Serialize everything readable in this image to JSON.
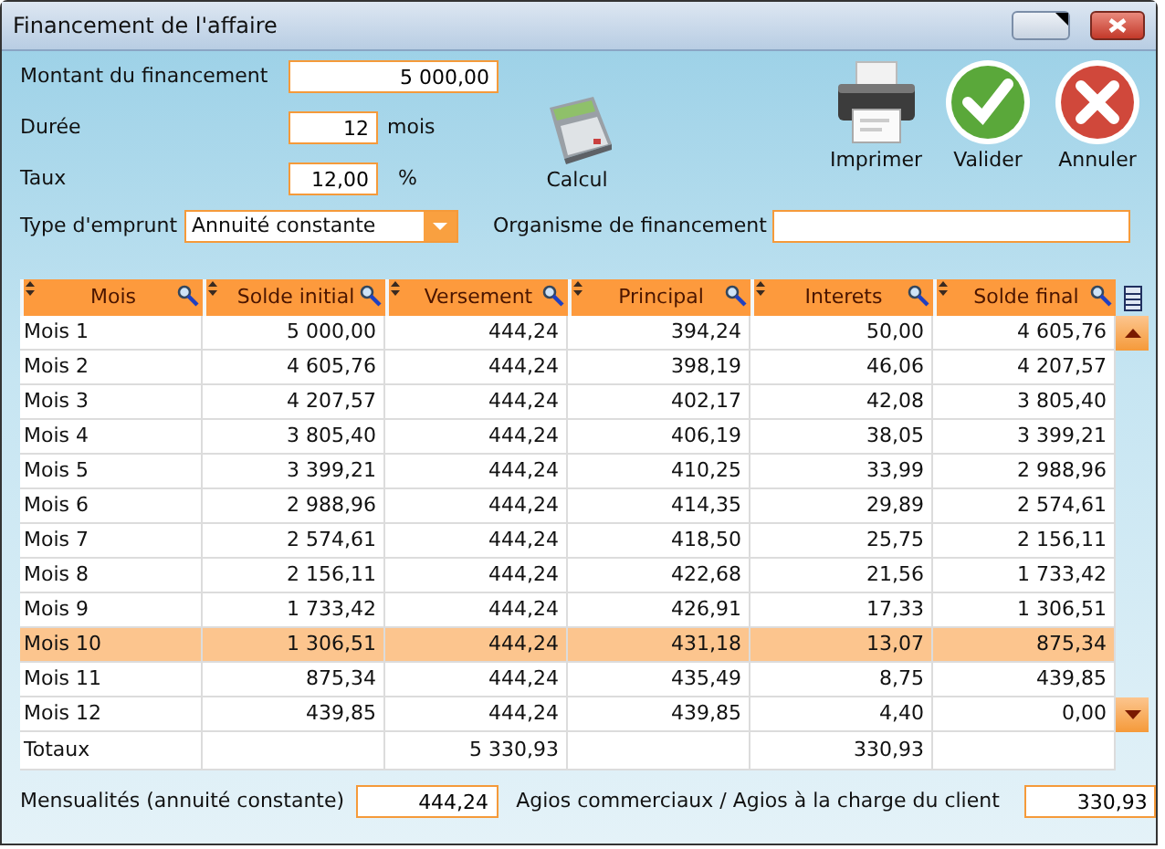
{
  "window": {
    "title": "Financement de l'affaire"
  },
  "amount": {
    "label": "Montant du financement",
    "value": "5 000,00"
  },
  "duration": {
    "label": "Durée",
    "value": "12",
    "unit": "mois"
  },
  "rate": {
    "label": "Taux",
    "value": "12,00",
    "unit": "%"
  },
  "actions": [
    {
      "label": "Calcul",
      "kind": "calculator"
    },
    {
      "label": "Imprimer",
      "kind": "print"
    },
    {
      "label": "Valider",
      "kind": "ok"
    },
    {
      "label": "Annuler",
      "kind": "cancel"
    }
  ],
  "loan_type": {
    "label": "Type d'emprunt",
    "value": "Annuité constante"
  },
  "lender": {
    "label": "Organisme de financement"
  },
  "table": {
    "columns": [
      "Mois",
      "Solde initial",
      "Versement",
      "Principal",
      "Interets",
      "Solde final"
    ],
    "rows": [
      {
        "selected": false,
        "cells": [
          "Mois 1",
          "5 000,00",
          "444,24",
          "394,24",
          "50,00",
          "4 605,76"
        ]
      },
      {
        "selected": false,
        "cells": [
          "Mois 2",
          "4 605,76",
          "444,24",
          "398,19",
          "46,06",
          "4 207,57"
        ]
      },
      {
        "selected": false,
        "cells": [
          "Mois 3",
          "4 207,57",
          "444,24",
          "402,17",
          "42,08",
          "3 805,40"
        ]
      },
      {
        "selected": false,
        "cells": [
          "Mois 4",
          "3 805,40",
          "444,24",
          "406,19",
          "38,05",
          "3 399,21"
        ]
      },
      {
        "selected": false,
        "cells": [
          "Mois 5",
          "3 399,21",
          "444,24",
          "410,25",
          "33,99",
          "2 988,96"
        ]
      },
      {
        "selected": false,
        "cells": [
          "Mois 6",
          "2 988,96",
          "444,24",
          "414,35",
          "29,89",
          "2 574,61"
        ]
      },
      {
        "selected": false,
        "cells": [
          "Mois 7",
          "2 574,61",
          "444,24",
          "418,50",
          "25,75",
          "2 156,11"
        ]
      },
      {
        "selected": false,
        "cells": [
          "Mois 8",
          "2 156,11",
          "444,24",
          "422,68",
          "21,56",
          "1 733,42"
        ]
      },
      {
        "selected": false,
        "cells": [
          "Mois 9",
          "1 733,42",
          "444,24",
          "426,91",
          "17,33",
          "1 306,51"
        ]
      },
      {
        "selected": true,
        "cells": [
          "Mois 10",
          "1 306,51",
          "444,24",
          "431,18",
          "13,07",
          "875,34"
        ]
      },
      {
        "selected": false,
        "cells": [
          "Mois 11",
          "875,34",
          "444,24",
          "435,49",
          "8,75",
          "439,85"
        ]
      },
      {
        "selected": false,
        "cells": [
          "Mois 12",
          "439,85",
          "444,24",
          "439,85",
          "4,40",
          "0,00"
        ]
      }
    ],
    "totals": {
      "label": "Totaux",
      "versement": "5 330,93",
      "interets": "330,93"
    }
  },
  "monthly": {
    "label": "Mensualités (annuité constante)",
    "value": "444,24"
  },
  "fees": {
    "label": "Agios commerciaux / Agios à la charge du client",
    "value": "330,93"
  }
}
